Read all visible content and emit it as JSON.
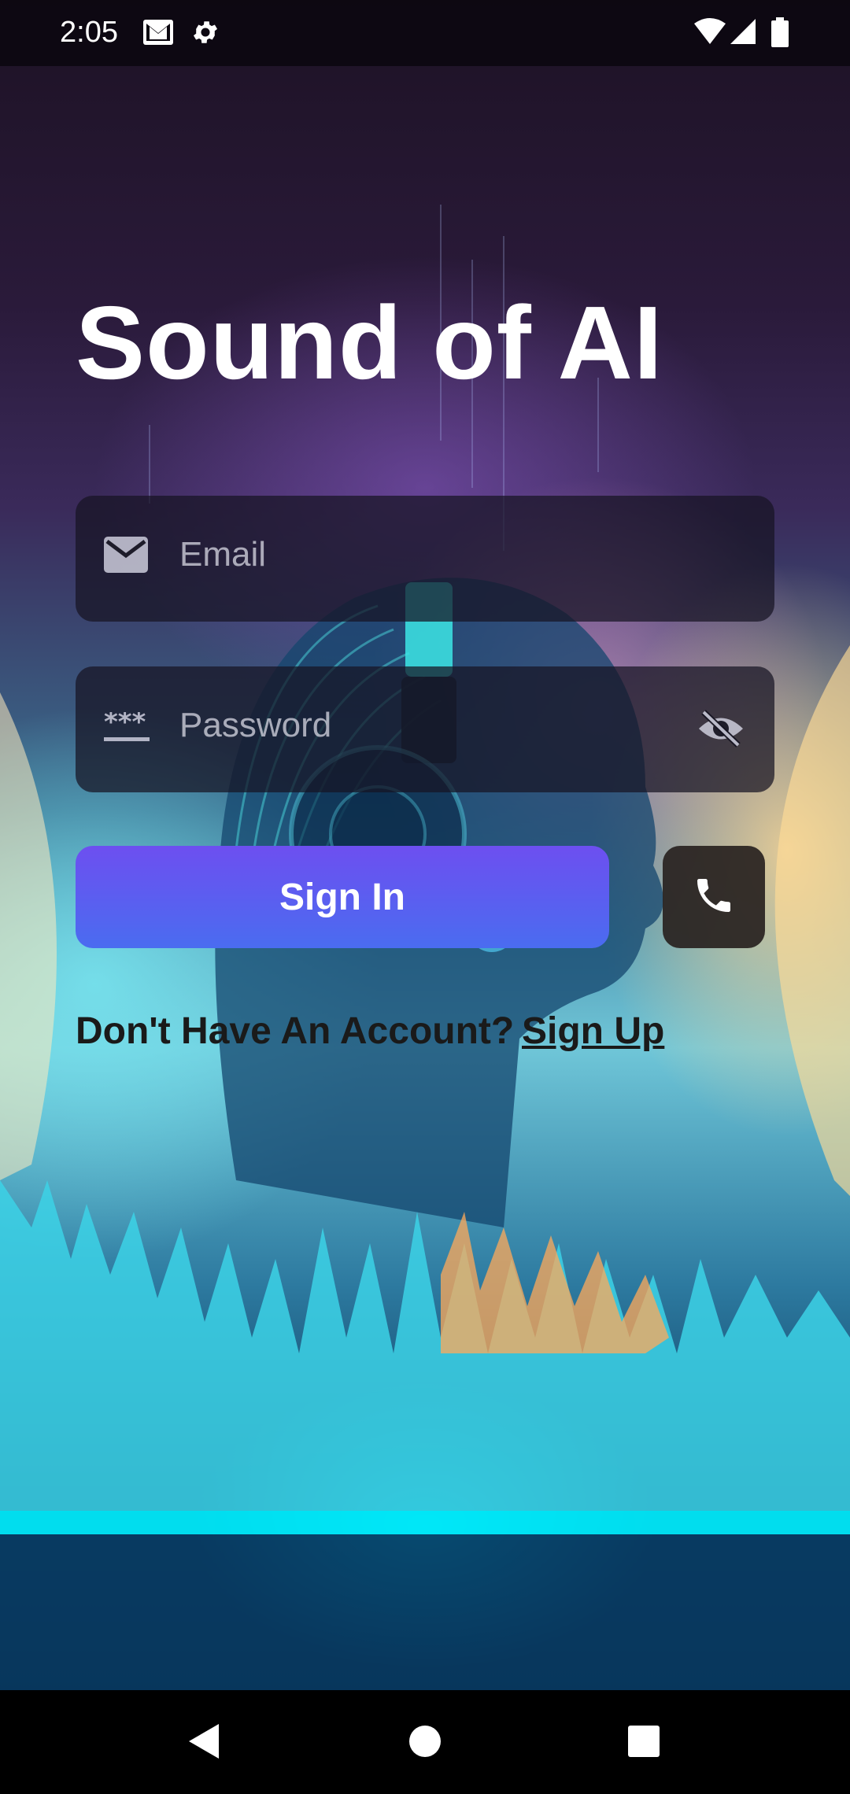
{
  "status_bar": {
    "time": "2:05",
    "icons": [
      "gmail-icon",
      "settings-icon",
      "wifi-icon",
      "signal-icon",
      "battery-icon"
    ]
  },
  "app": {
    "title": "Sound of AI"
  },
  "form": {
    "email_placeholder": "Email",
    "password_placeholder": "Password",
    "sign_in_label": "Sign In",
    "no_account_text": "Don't Have An Account?",
    "sign_up_label": "Sign Up"
  },
  "nav_bar": {
    "buttons": [
      "back",
      "home",
      "recents"
    ]
  },
  "colors": {
    "button_gradient_start": "#6d4ff0",
    "button_gradient_end": "#4a6cf0",
    "field_background": "#161422",
    "text_dark": "#1a1a1a"
  }
}
